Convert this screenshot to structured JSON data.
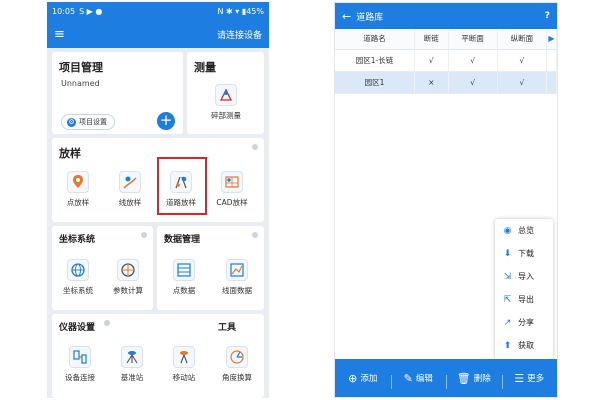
{
  "left_screen": {
    "status": {
      "time": "10:05",
      "icons": "S ▶ ●",
      "right": "N ✱ ▾ ▮45%"
    },
    "appbar": {
      "menu_icon": "hamburger-icon",
      "connect_label": "请连接设备"
    },
    "project_card": {
      "title": "项目管理",
      "project_name": "Unnamed",
      "settings_label": "项目设置",
      "add_icon": "plus-icon"
    },
    "survey_card": {
      "title": "测量",
      "tool_label": "碎部测量"
    },
    "stakeout_card": {
      "title": "放样",
      "tools": [
        {
          "label": "点放样",
          "icon": "point-stakeout-icon"
        },
        {
          "label": "线放样",
          "icon": "line-stakeout-icon"
        },
        {
          "label": "道路放样",
          "icon": "road-stakeout-icon"
        },
        {
          "label": "CAD放样",
          "icon": "cad-stakeout-icon"
        }
      ]
    },
    "coord_card": {
      "title": "坐标系统",
      "tools": [
        {
          "label": "坐标系统"
        },
        {
          "label": "参数计算"
        }
      ]
    },
    "data_card": {
      "title": "数据管理",
      "tools": [
        {
          "label": "点数据"
        },
        {
          "label": "线面数据"
        }
      ]
    },
    "instrument_card": {
      "title": "仪器设置",
      "tools": [
        {
          "label": "设备连接"
        },
        {
          "label": "基准站"
        },
        {
          "label": "移动站"
        }
      ]
    },
    "tools_card": {
      "title": "工具",
      "tools": [
        {
          "label": "角度换算"
        }
      ]
    }
  },
  "right_screen": {
    "title": "道路库",
    "help": "?",
    "table": {
      "headers": [
        "道路名",
        "断链",
        "平断面",
        "纵断面"
      ],
      "more_indicator": "▶",
      "rows": [
        {
          "name": "园区1-长链",
          "cells": [
            "√",
            "√",
            "√"
          ]
        },
        {
          "name": "园区1",
          "cells": [
            "×",
            "√",
            "√"
          ]
        }
      ]
    },
    "menu": [
      {
        "label": "总览",
        "icon": "eye-icon",
        "glyph": "◉"
      },
      {
        "label": "下载",
        "icon": "cloud-download-icon",
        "glyph": "⬇"
      },
      {
        "label": "导入",
        "icon": "import-icon",
        "glyph": "⇲"
      },
      {
        "label": "导出",
        "icon": "export-icon",
        "glyph": "⇱"
      },
      {
        "label": "分享",
        "icon": "share-icon",
        "glyph": "↗"
      },
      {
        "label": "获取",
        "icon": "fetch-icon",
        "glyph": "⬆"
      }
    ],
    "bottom_bar": [
      {
        "label": "添加",
        "glyph": "⊕"
      },
      {
        "label": "编辑",
        "glyph": "✎"
      },
      {
        "label": "删除",
        "glyph": "🗑"
      },
      {
        "label": "更多",
        "glyph": "☰"
      }
    ]
  },
  "colors": {
    "primary": "#1d7de0",
    "highlight": "#d9262b",
    "selected_row": "#dbe8f7"
  }
}
